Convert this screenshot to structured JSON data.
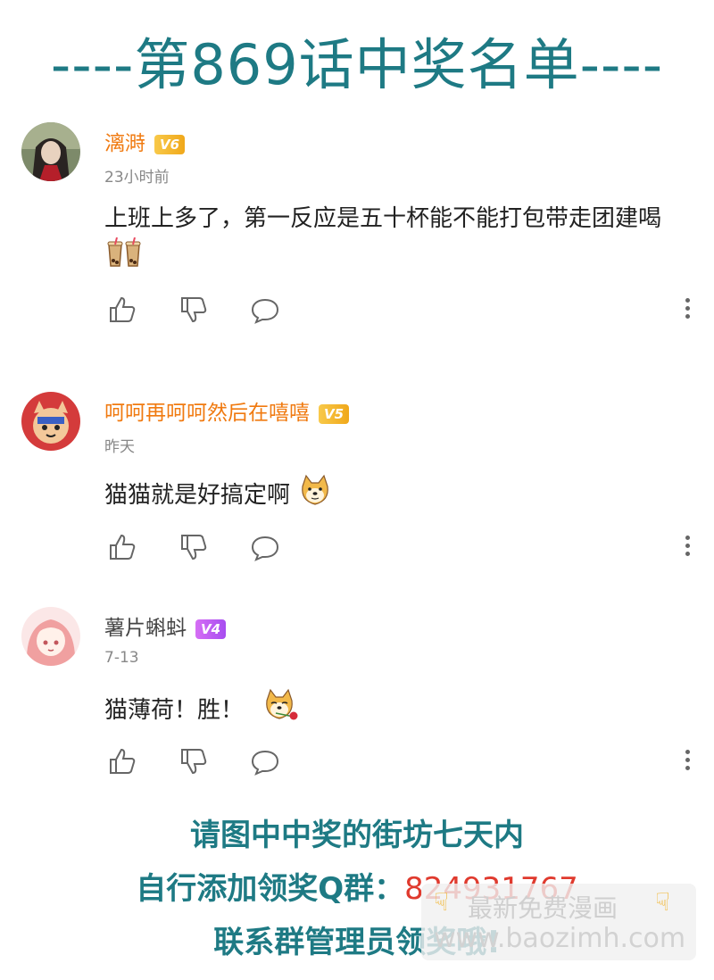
{
  "title": "----第869话中奖名单----",
  "comments": [
    {
      "username": "漓溡",
      "level": "V6",
      "time": "23小时前",
      "text": "上班上多了，第一反应是五十杯能不能打包带走团建喝",
      "emoji": "bubble-tea-emoji"
    },
    {
      "username": "呵呵再呵呵然后在嘻嘻",
      "level": "V5",
      "time": "昨天",
      "text": "猫猫就是好搞定啊",
      "emoji": "doge-emoji"
    },
    {
      "username": "薯片蝌蚪",
      "level": "V4",
      "time": "7-13",
      "text": "猫薄荷！胜！",
      "emoji": "doge-rose-emoji"
    }
  ],
  "footer": {
    "line1": "请图中中奖的街坊七天内",
    "line2_prefix": "自行添加领奖Q群：",
    "qq_group": "824931767",
    "line3": "联系群管理员领奖哦!"
  },
  "watermark": {
    "line1": "最新免费漫画",
    "line2": "www.baozimh.com"
  },
  "colors": {
    "title": "#1e7a84",
    "username_orange": "#f07a10",
    "qq_red": "#e03a2e"
  }
}
